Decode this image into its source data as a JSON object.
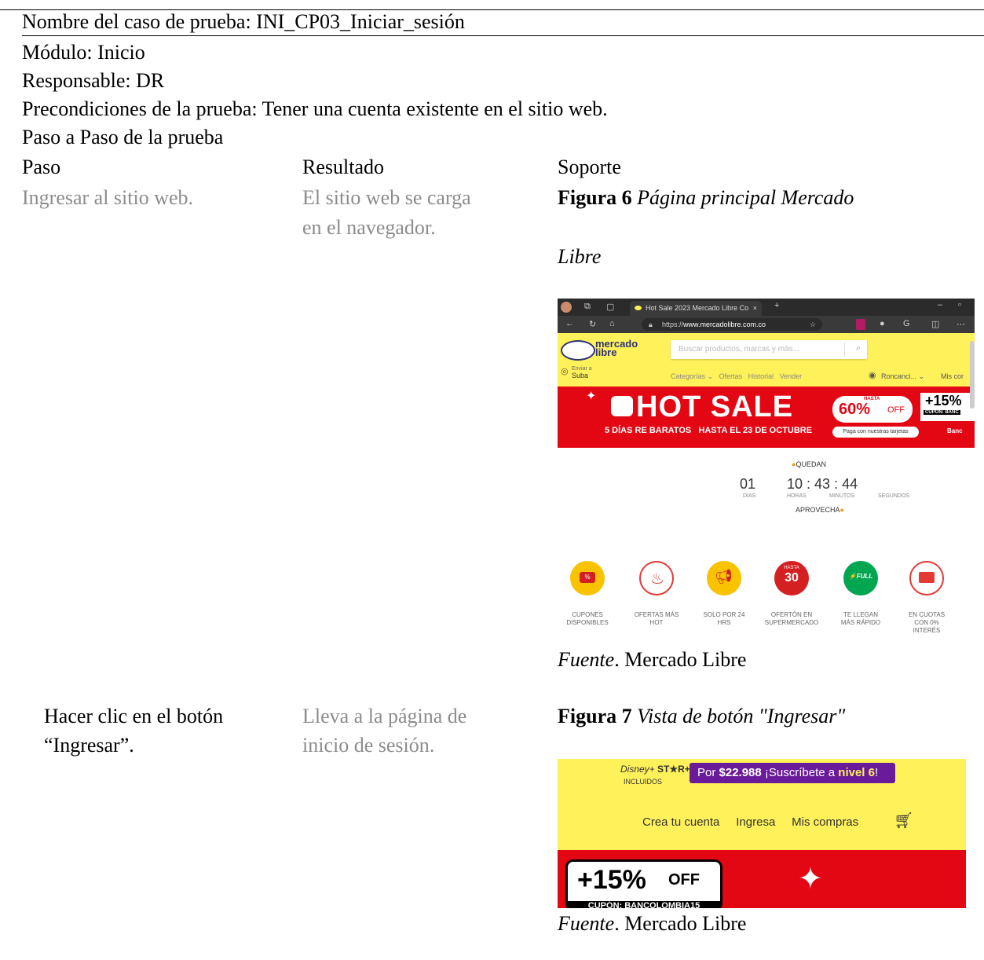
{
  "header": {
    "test_name": "Nombre del caso de prueba: INI_CP03_Iniciar_sesión",
    "module": "Módulo: Inicio",
    "responsible": "Responsable: DR",
    "preconditions": "Precondiciones de la prueba: Tener una cuenta existente en el sitio web.",
    "steps_title": "Paso a Paso de la prueba"
  },
  "columns": {
    "step": "Paso",
    "result": "Resultado",
    "support": "Soporte"
  },
  "rows": [
    {
      "step": "Ingresar al sitio web.",
      "result_l1": "El sitio web se carga",
      "result_l2": "en el navegador.",
      "fig_num": "Figura 6",
      "fig_title_l1": "Página principal Mercado",
      "fig_title_l2": "Libre",
      "source_label": "Fuente",
      "source_text": ". Mercado Libre"
    },
    {
      "step_l1": "Hacer clic en el botón",
      "step_l2": "“Ingresar”.",
      "result_l1": "Lleva a la página de",
      "result_l2": "inicio de sesión.",
      "fig_num": "Figura 7",
      "fig_title": "Vista de botón \"Ingresar\"",
      "source_label": "Fuente",
      "source_text": ". Mercado Libre"
    }
  ],
  "fig6": {
    "tab_title": "Hot Sale 2023 Mercado Libre Co",
    "url_prefix": "https://",
    "url_host": "www.mercadolibre.com.co",
    "logo_l1": "mercado",
    "logo_l2": "libre",
    "search_placeholder": "Buscar productos, marcas y más...",
    "ship_l1": "Enviar a",
    "ship_l2": "Suba",
    "nav": [
      "Categorías ⌄",
      "Ofertas",
      "Historial",
      "Vender"
    ],
    "user": "Roncanci... ⌄",
    "mis": "Mis cor",
    "banner_main": "HOT SALE",
    "banner_sub_a": "5 DÍAS RE BARATOS",
    "banner_sub_b": "HASTA EL 23 DE OCTUBRE",
    "badge_hasta": "HASTA",
    "badge_pct": "60%",
    "badge_off": "OFF",
    "plus15": "+15%",
    "cupon": "CUPÓN: BANC",
    "paga": "Paga con nuestras tarjetas",
    "banc": "Banc",
    "quedan": "QUEDAN",
    "days": "01",
    "days_lbl": "DÍAS",
    "hours": "10",
    "hours_lbl": "HORAS",
    "minutes": "43",
    "minutes_lbl": "MINUTOS",
    "seconds": "44",
    "seconds_lbl": "SEGUNDOS",
    "aprovecha": "APROVECHA",
    "cats": [
      {
        "l1": "CUPONES",
        "l2": "DISPONIBLES",
        "l3": ""
      },
      {
        "l1": "OFERTAS MÁS",
        "l2": "HOT",
        "l3": ""
      },
      {
        "l1": "SOLO POR 24",
        "l2": "HRS",
        "l3": ""
      },
      {
        "l1": "OFERTÓN EN",
        "l2": "SUPERMERCADO",
        "l3": ""
      },
      {
        "l1": "TE LLEGAN",
        "l2": "MÁS RÁPIDO",
        "l3": ""
      },
      {
        "l1": "EN CUOTAS",
        "l2": "CON 0%",
        "l3": "INTERÉS"
      }
    ],
    "badge30_hasta": "HASTA",
    "badge30": "30",
    "full": "FULL",
    "colors": {
      "yellow": "#fff159",
      "red": "#e30613",
      "green": "#00a650"
    }
  },
  "fig7": {
    "disney": "Disney+",
    "star": "ST★R+",
    "incluidos": "INCLUIDOS",
    "promo_a": "Por ",
    "promo_price": "$22.988",
    "promo_b": " ¡Suscríbete a ",
    "promo_level": "nivel 6",
    "promo_c": "!",
    "links": [
      "Crea tu cuenta",
      "Ingresa",
      "Mis compras"
    ],
    "coupon_pct": "+15%",
    "coupon_off": "OFF",
    "coupon_code": "CUPÓN: BANCOLOMBIA15"
  }
}
